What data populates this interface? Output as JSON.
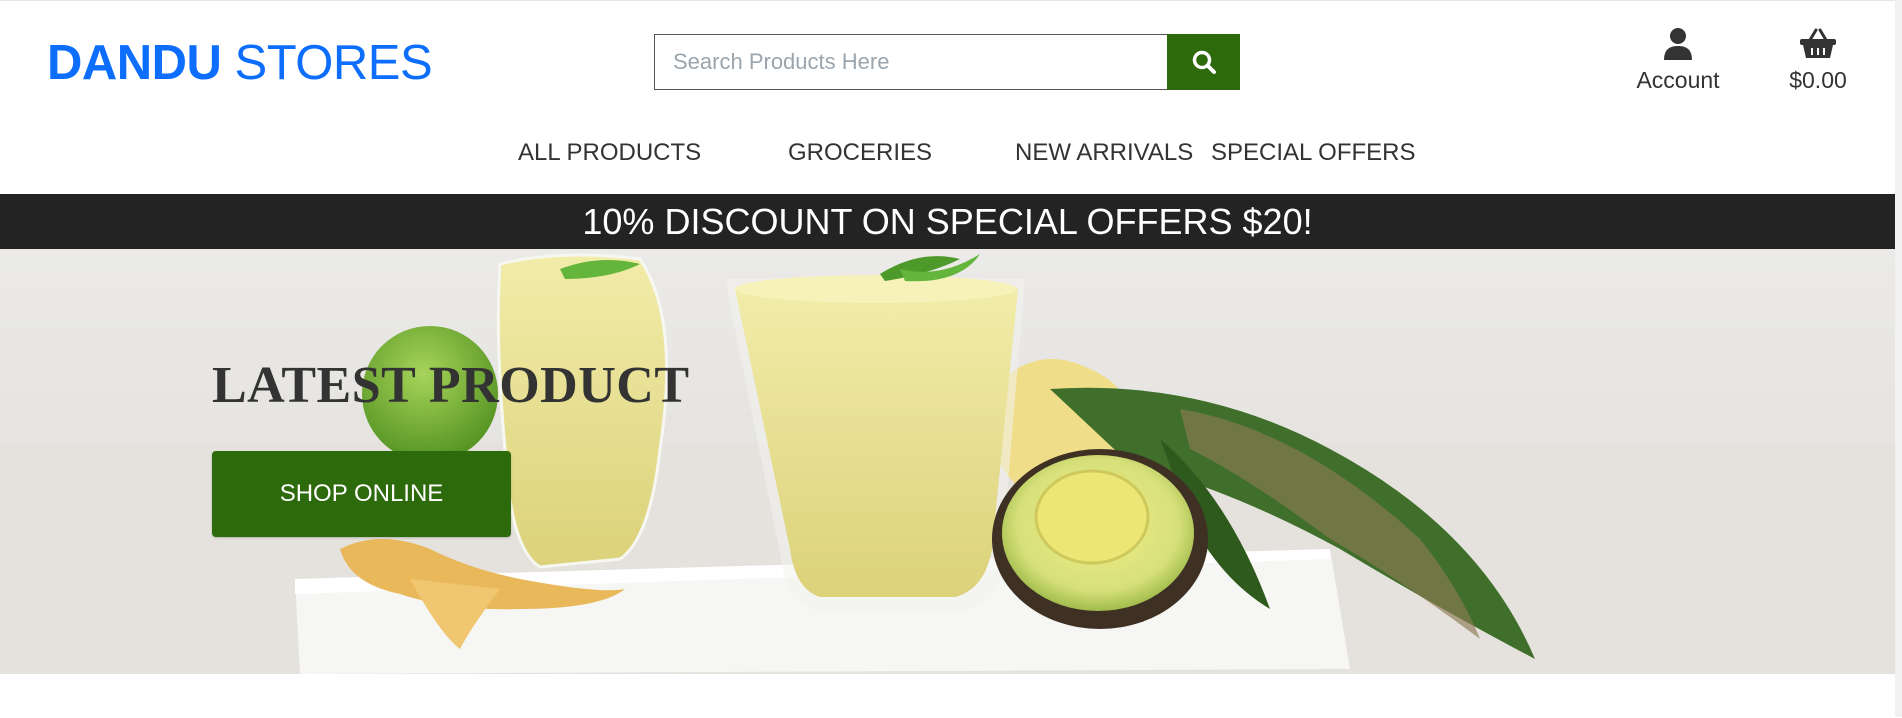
{
  "header": {
    "logo_bold": "DANDU",
    "logo_rest": " STORES",
    "search": {
      "placeholder": "Search Products Here",
      "button_icon": "search-icon"
    },
    "account": {
      "label": "Account",
      "icon": "user-icon"
    },
    "cart": {
      "total": "$0.00",
      "icon": "basket-icon"
    }
  },
  "nav": {
    "items": [
      {
        "label": "ALL PRODUCTS"
      },
      {
        "label": "GROCERIES"
      },
      {
        "label": "NEW ARRIVALS"
      },
      {
        "label": "SPECIAL OFFERS"
      }
    ]
  },
  "banner": {
    "text": "10% DISCOUNT ON SPECIAL OFFERS $20!"
  },
  "hero": {
    "title": "LATEST PRODUCT",
    "button": "SHOP ONLINE"
  },
  "colors": {
    "brand_blue": "#0d6efd",
    "accent_green": "#2d6a0b",
    "banner_bg": "#232323"
  }
}
